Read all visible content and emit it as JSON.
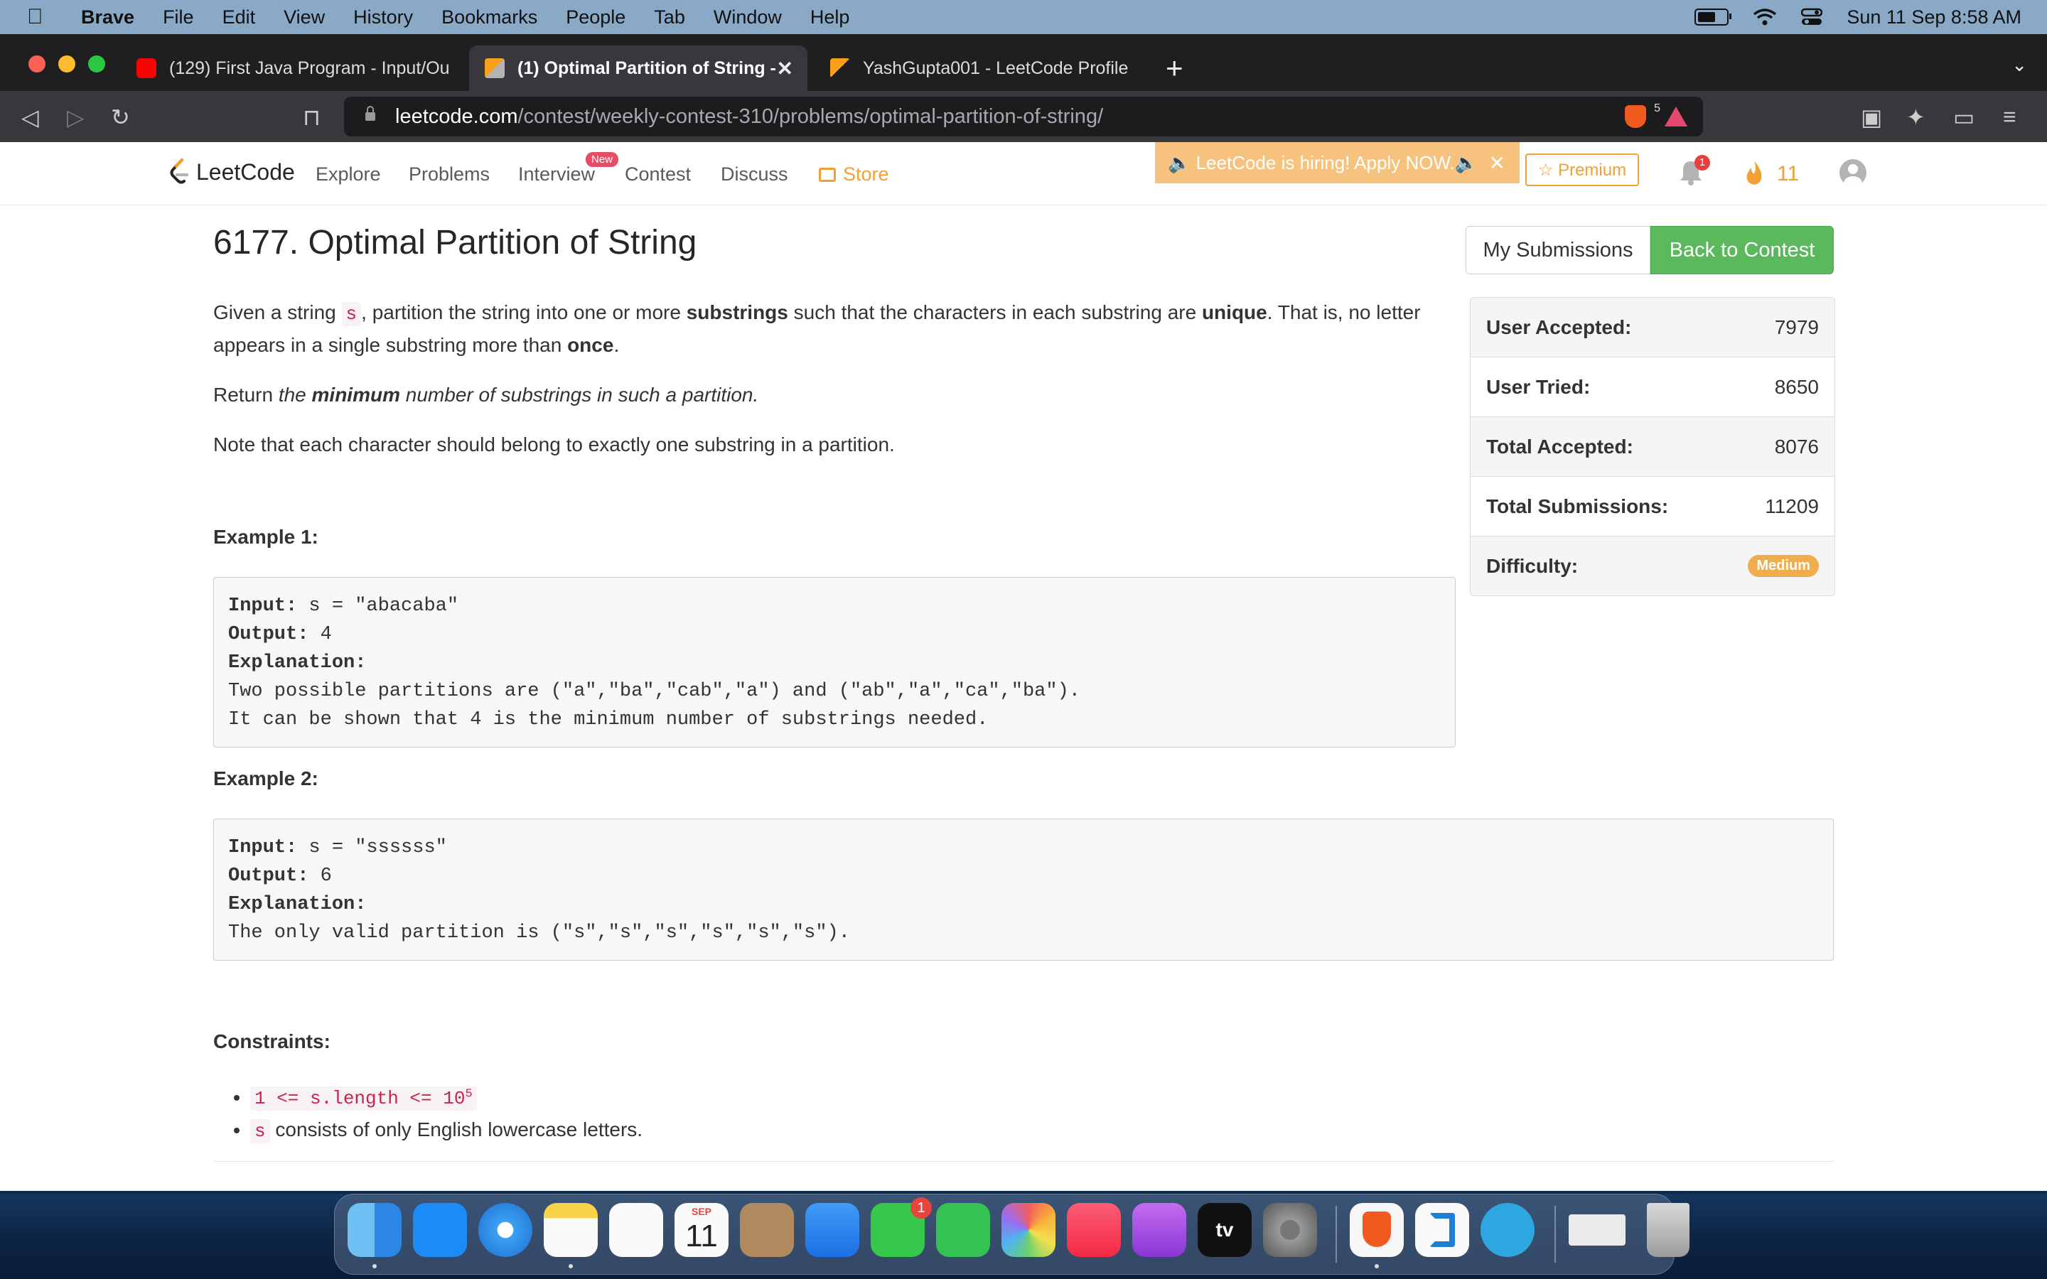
{
  "menubar": {
    "app": "Brave",
    "items": [
      "File",
      "Edit",
      "View",
      "History",
      "Bookmarks",
      "People",
      "Tab",
      "Window",
      "Help"
    ],
    "clock": "Sun 11 Sep  8:58 AM"
  },
  "tabs": [
    {
      "title": "(129) First Java Program - Input/Ou",
      "favicon": "youtube-icon"
    },
    {
      "title": "(1) Optimal Partition of String -",
      "favicon": "leetcode-icon",
      "active": true
    },
    {
      "title": "YashGupta001 - LeetCode Profile",
      "favicon": "leetcode-icon"
    }
  ],
  "toolbar": {
    "url_domain": "leetcode.com",
    "url_path": "/contest/weekly-contest-310/problems/optimal-partition-of-string/",
    "shield_count": "5"
  },
  "lcnav": {
    "logo": "LeetCode",
    "links": [
      "Explore",
      "Problems",
      "Interview",
      "Contest",
      "Discuss"
    ],
    "new_badge": "New",
    "store": "Store",
    "hiring": "🔈 LeetCode is hiring! Apply NOW.🔈",
    "premium": "☆ Premium",
    "bell_count": "1",
    "streak": "11"
  },
  "problem": {
    "title": "6177. Optimal Partition of String",
    "my_submissions": "My Submissions",
    "back_to_contest": "Back to Contest",
    "desc1_a": "Given a string ",
    "desc1_code": "s",
    "desc1_b": ", partition the string into one or more ",
    "desc1_bold1": "substrings",
    "desc1_c": " such that the characters in each substring are ",
    "desc1_bold2": "unique",
    "desc1_d": ". That is, no letter appears in a single substring more than ",
    "desc1_bold3": "once",
    "desc1_e": ".",
    "desc2_a": "Return ",
    "desc2_i1": "the ",
    "desc2_bi": "minimum",
    "desc2_i2": " number of substrings in such a partition.",
    "desc3": "Note that each character should belong to exactly one substring in a partition.",
    "example1_title": "Example 1:",
    "example1": {
      "input_label": "Input:",
      "input": " s = \"abacaba\"",
      "output_label": "Output:",
      "output": " 4",
      "explanation_label": "Explanation:",
      "explanation_1": "Two possible partitions are (\"a\",\"ba\",\"cab\",\"a\") and (\"ab\",\"a\",\"ca\",\"ba\").",
      "explanation_2": "It can be shown that 4 is the minimum number of substrings needed."
    },
    "example2_title": "Example 2:",
    "example2": {
      "input_label": "Input:",
      "input": " s = \"ssssss\"",
      "output_label": "Output:",
      "output": " 6",
      "explanation_label": "Explanation:",
      "explanation_1": "The only valid partition is (\"s\",\"s\",\"s\",\"s\",\"s\",\"s\")."
    },
    "constraints_title": "Constraints:",
    "constraint1_code": "1 <= s.length <= 10",
    "constraint1_sup": "5",
    "constraint2_code": "s",
    "constraint2_text": " consists of only English lowercase letters."
  },
  "stats": [
    {
      "label": "User Accepted:",
      "value": "7979"
    },
    {
      "label": "User Tried:",
      "value": "8650"
    },
    {
      "label": "Total Accepted:",
      "value": "8076"
    },
    {
      "label": "Total Submissions:",
      "value": "11209"
    }
  ],
  "difficulty": {
    "label": "Difficulty:",
    "value": "Medium"
  },
  "dock": {
    "calendar_month": "SEP",
    "calendar_day": "11",
    "messages_badge": "1",
    "appletv_label": "tv"
  },
  "colors": {
    "accent_green": "#5cb85c",
    "leetcode_orange": "#f0a034",
    "medium_badge": "#f0ad4e"
  }
}
